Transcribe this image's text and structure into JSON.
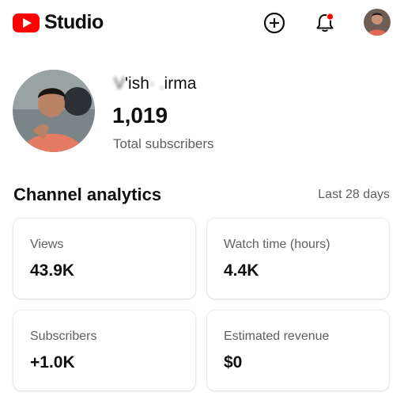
{
  "header": {
    "app_name": "Studio",
    "brand_color": "#ff0000",
    "create_icon": "add-circle-icon",
    "notification_icon": "bell-icon",
    "notification_badge_color": "#ff0000"
  },
  "channel": {
    "name_obscured_left": "V",
    "name_visible_1": "'ish",
    "name_obscured_mid": "· .",
    "name_visible_2": "irma",
    "subscriber_count": "1,019",
    "subscriber_label": "Total subscribers"
  },
  "analytics": {
    "title": "Channel analytics",
    "range": "Last 28 days",
    "cards": [
      {
        "label": "Views",
        "value": "43.9K"
      },
      {
        "label": "Watch time (hours)",
        "value": "4.4K"
      },
      {
        "label": "Subscribers",
        "value": "+1.0K"
      },
      {
        "label": "Estimated revenue",
        "value": "$0"
      }
    ]
  }
}
